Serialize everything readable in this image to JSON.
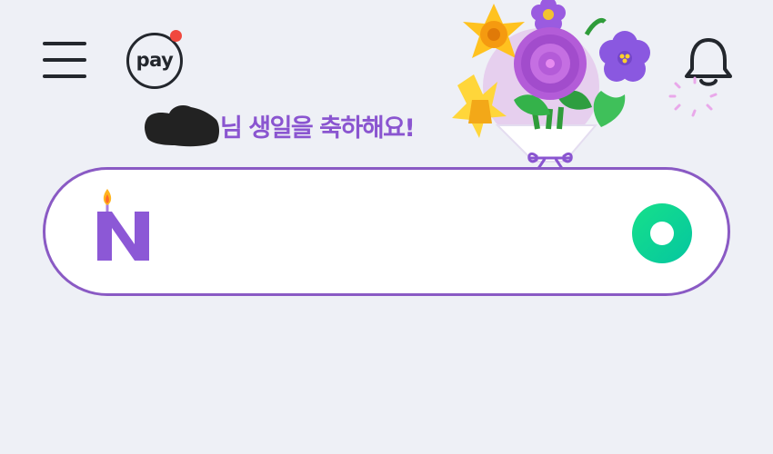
{
  "header": {
    "menu_icon": "hamburger-menu-icon",
    "pay_label": "pay",
    "pay_badge_color": "#f0483e",
    "notification_icon": "bell-icon"
  },
  "greeting": {
    "name": "",
    "text": "님 생일을 축하해요!",
    "text_color": "#8a55d0",
    "decoration": "flower-bouquet"
  },
  "search": {
    "logo": "N",
    "logo_decoration": "birthday-candle",
    "logo_color": "#8c58d6",
    "border_color": "#8a5ac4",
    "value": "",
    "placeholder": "",
    "action_icon": "green-circle-icon"
  },
  "colors": {
    "background": "#eef0f6",
    "accent": "#8a55d0",
    "green": "#0fd67f"
  }
}
